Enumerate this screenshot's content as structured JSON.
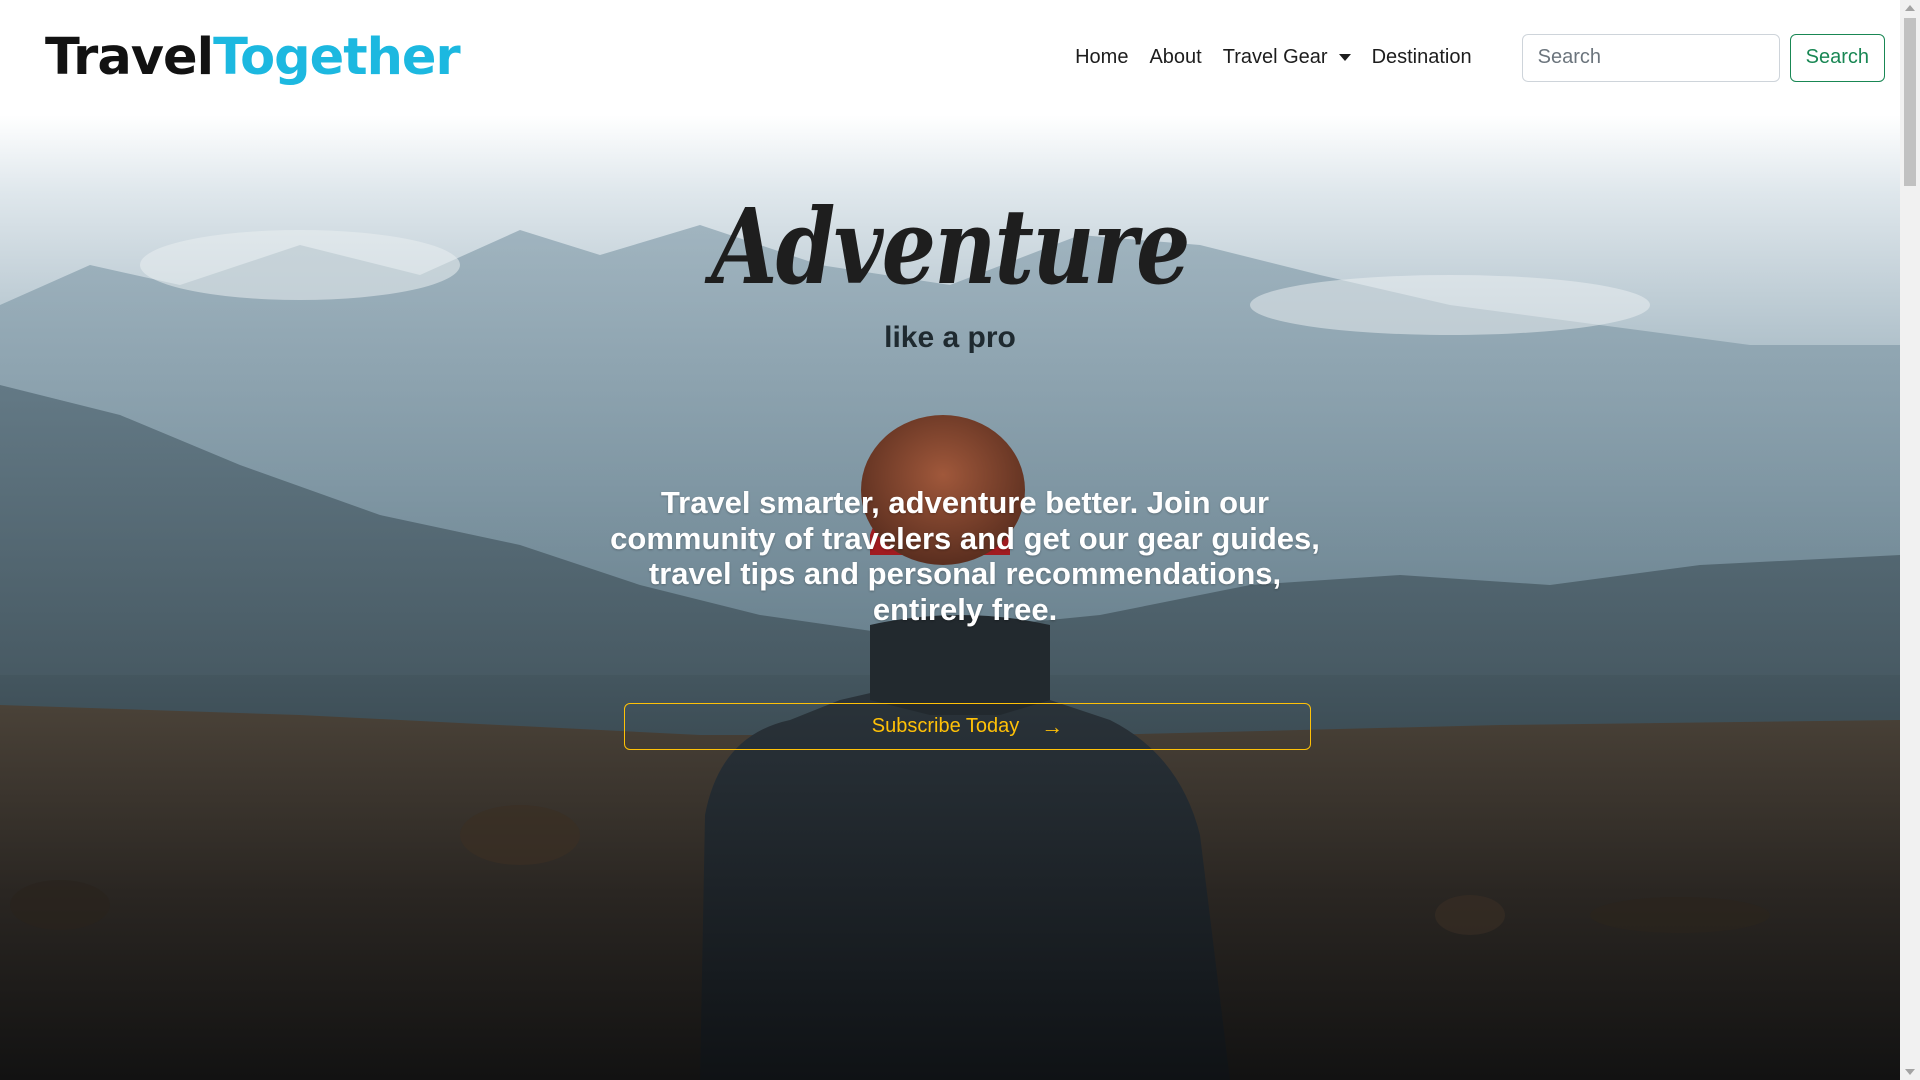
{
  "brand": {
    "part1": "Travel",
    "part2": "Together"
  },
  "nav": {
    "home": "Home",
    "about": "About",
    "travel_gear": "Travel Gear",
    "destination": "Destination"
  },
  "search": {
    "placeholder": "Search",
    "button": "Search"
  },
  "hero": {
    "title": "Adventure",
    "subtitle": "like a pro",
    "text": "Travel smarter, adventure better. Join our community of travelers and get our gear guides, travel tips and personal recommendations, entirely free.",
    "cta": "Subscribe Today",
    "cta_icon": "arrow-right-icon"
  },
  "colors": {
    "brand_dark": "#121212",
    "brand_accent": "#1cb8e0",
    "search_green": "#198754",
    "cta_yellow": "#ffc107"
  }
}
